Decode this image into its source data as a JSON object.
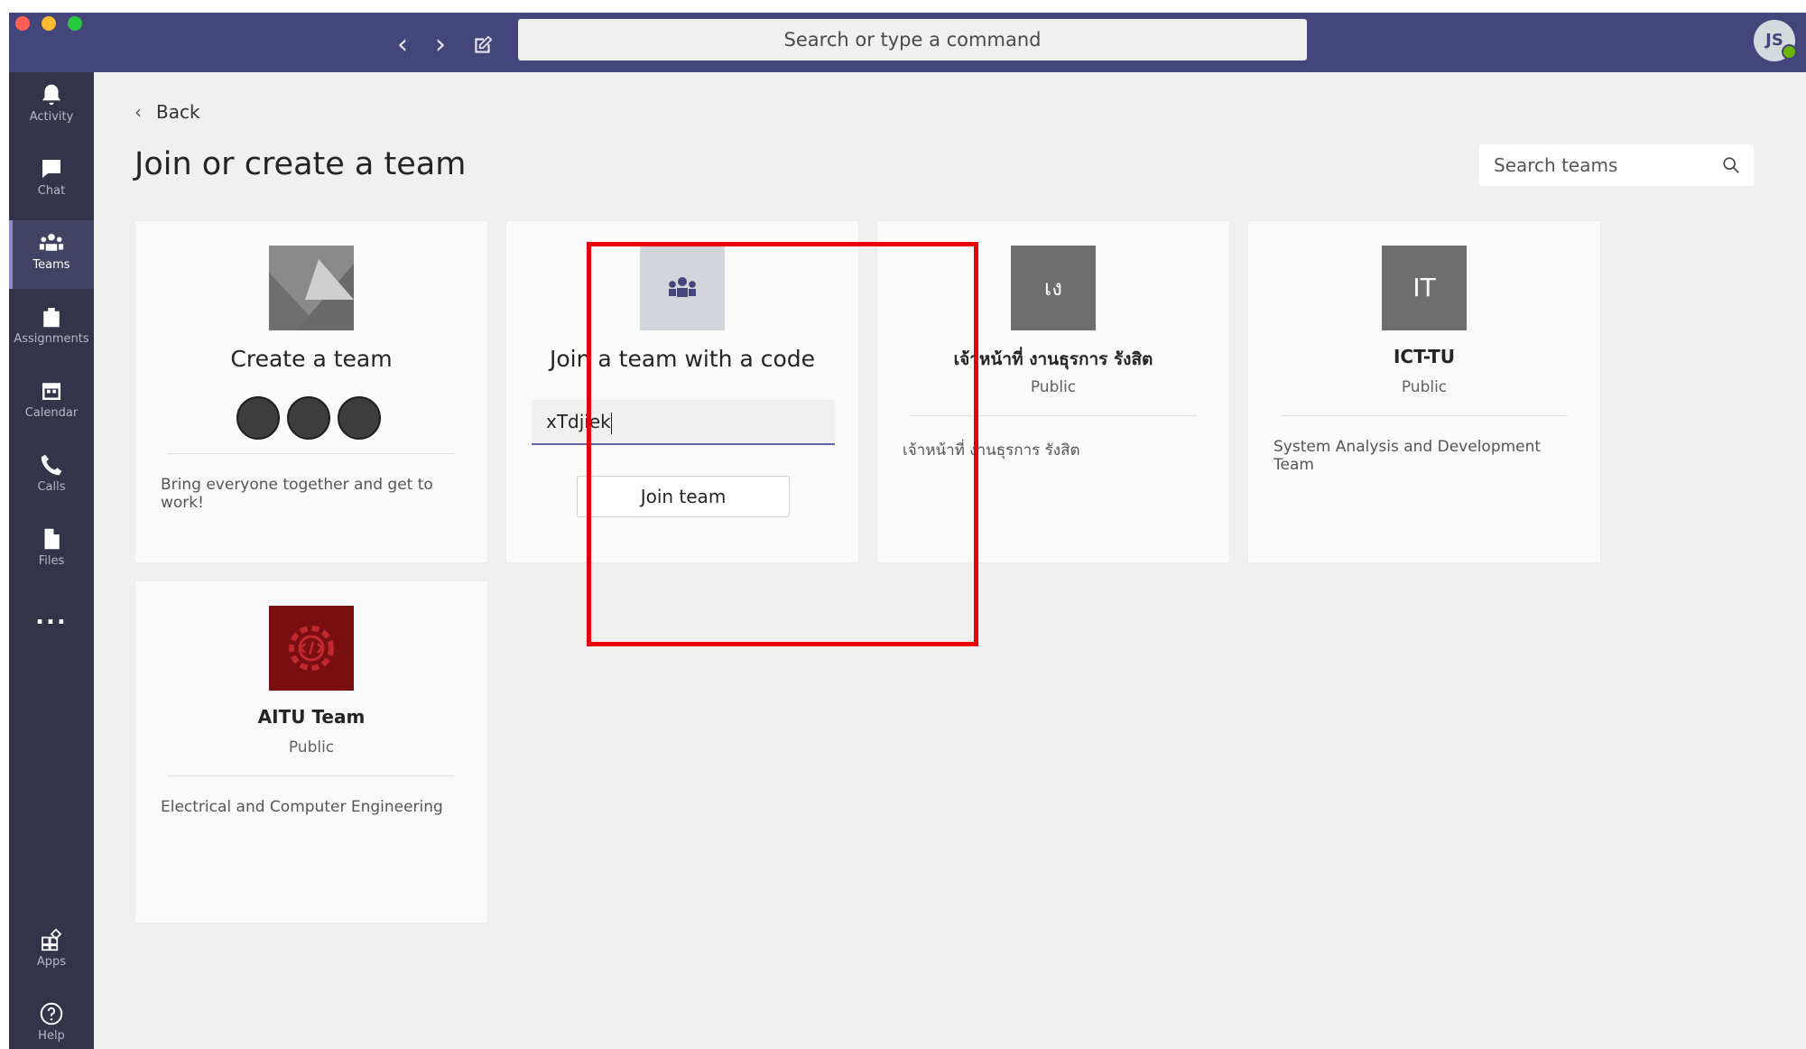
{
  "titlebar": {
    "search_placeholder": "Search or type a command",
    "avatar_initials": "JS"
  },
  "rail": {
    "items": [
      {
        "label": "Activity",
        "icon": "bell-icon"
      },
      {
        "label": "Chat",
        "icon": "chat-icon"
      },
      {
        "label": "Teams",
        "icon": "teams-icon",
        "active": true
      },
      {
        "label": "Assignments",
        "icon": "assignments-icon"
      },
      {
        "label": "Calendar",
        "icon": "calendar-icon"
      },
      {
        "label": "Calls",
        "icon": "phone-icon"
      },
      {
        "label": "Files",
        "icon": "file-icon"
      },
      {
        "label": "...",
        "icon": "more-icon"
      },
      {
        "label": "Apps",
        "icon": "apps-icon"
      },
      {
        "label": "Help",
        "icon": "help-icon"
      }
    ]
  },
  "main": {
    "back_label": "Back",
    "title": "Join or create a team",
    "search_placeholder": "Search teams"
  },
  "cards": {
    "create": {
      "title": "Create a team",
      "desc": "Bring everyone together and get to work!"
    },
    "join": {
      "title": "Join a team with a code",
      "code_value": "xTdjiek",
      "button": "Join team"
    },
    "team1": {
      "initials": "เง",
      "name": "เจ้าหน้าที่ งานธุรการ รังสิต",
      "visibility": "Public",
      "desc": "เจ้าหน้าที่ งานธุรการ รังสิต"
    },
    "team2": {
      "initials": "IT",
      "name": "ICT-TU",
      "visibility": "Public",
      "desc": "System Analysis and Development Team"
    },
    "team3": {
      "name": "AITU Team",
      "visibility": "Public",
      "desc": "Electrical and Computer Engineering"
    }
  },
  "colors": {
    "titlebar": "#44457a",
    "rail": "#33344a",
    "accent": "#6264a7",
    "highlight": "#e8000d"
  }
}
